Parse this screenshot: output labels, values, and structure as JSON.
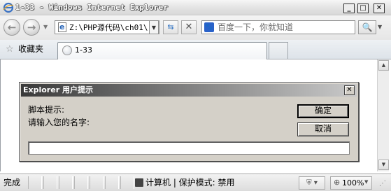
{
  "window": {
    "title": "1-33 - Windows Internet Explorer",
    "controls": {
      "minimize": "_",
      "maximize": "□",
      "close": "✕"
    }
  },
  "navigation": {
    "back_icon": "back-arrow-icon",
    "forward_icon": "forward-arrow-icon",
    "address": "Z:\\PHP源代码\\ch01\\",
    "search_placeholder": "百度一下，你就知道",
    "search_provider_glyph": "🐾"
  },
  "favorites_bar": {
    "favorites_label": "收藏夹",
    "tabs": [
      {
        "title": "1-33",
        "active": true
      }
    ]
  },
  "dialog": {
    "title": "Explorer 用户提示",
    "script_label": "脚本提示:",
    "prompt_message": "请输入您的名字:",
    "ok_label": "确定",
    "cancel_label": "取消",
    "input_value": ""
  },
  "status_bar": {
    "status_text": "完成",
    "zone_text": "计算机 | 保护模式: 禁用",
    "zoom_label": "100%"
  },
  "colors": {
    "dialog_face": "#d4d0c8",
    "dialog_title_start": "#3a3a3a",
    "dialog_title_end": "#c9c9c9",
    "chrome_background": "#e6e6e6"
  }
}
